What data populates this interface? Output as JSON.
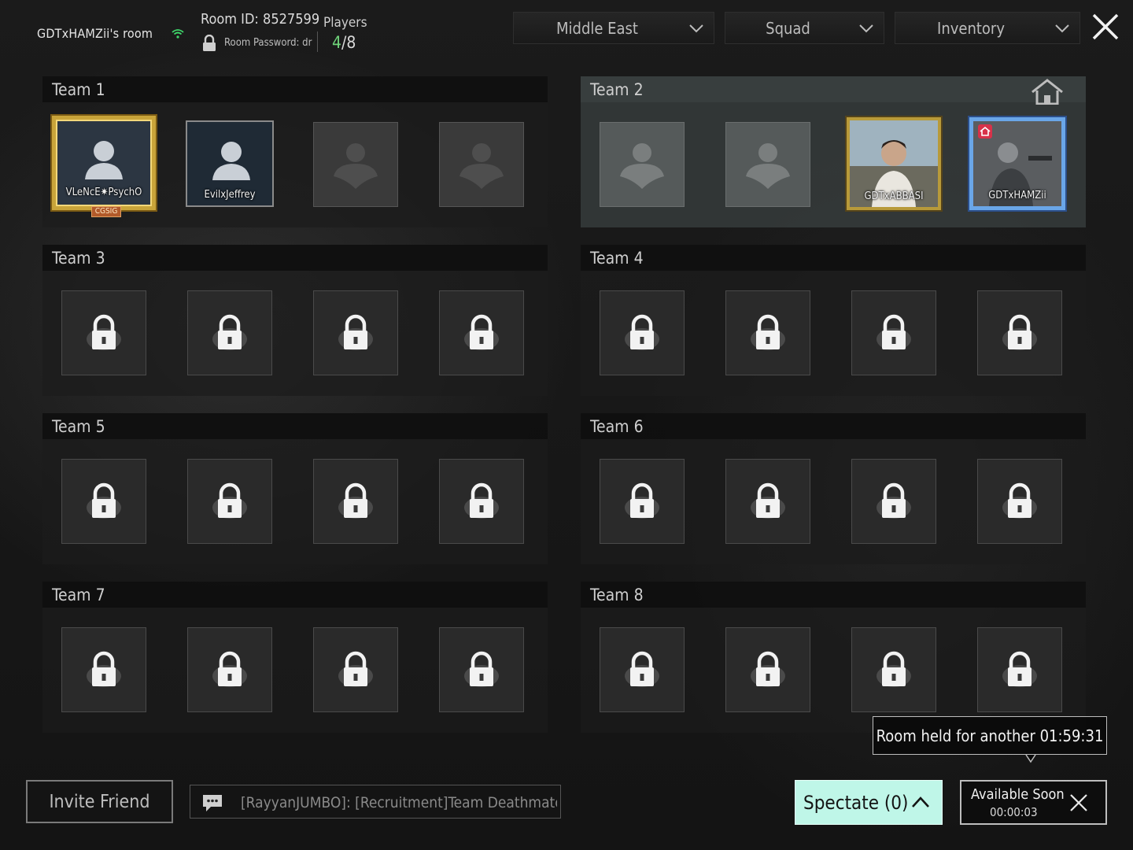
{
  "header": {
    "room_owner": "GDTxHAMZii's room",
    "room_id": "Room ID: 8527599",
    "room_password": "Room Password: dr",
    "players_label": "Players",
    "players_current": "4",
    "players_max": "/8",
    "region": "Middle East",
    "mode": "Squad",
    "inventory": "Inventory"
  },
  "teams": [
    {
      "name": "Team 1",
      "players": [
        "VLeNcE✷PsychO",
        "EvilxJeffrey"
      ],
      "clan_tag": "CGSIG"
    },
    {
      "name": "Team 2",
      "players": [
        "GDTxABBASI",
        "GDTxHAMZii"
      ]
    },
    {
      "name": "Team 3"
    },
    {
      "name": "Team 4"
    },
    {
      "name": "Team 5"
    },
    {
      "name": "Team 6"
    },
    {
      "name": "Team 7"
    },
    {
      "name": "Team 8"
    }
  ],
  "footer": {
    "room_held": "Room held for another 01:59:31",
    "invite_label": "Invite Friend",
    "chat_message": "[RayyanJUMBO]: [Recruitment]Team Deathmatc",
    "spectate_label": "Spectate (0)",
    "available_label": "Available Soon",
    "available_time": "00:00:03"
  },
  "icons": {
    "wifi": "wifi-icon",
    "lock": "lock-icon",
    "close": "close-icon",
    "chevron": "chevron-down-icon",
    "home": "home-icon",
    "chat": "chat-bubble-icon",
    "person": "person-silhouette-icon"
  },
  "colors": {
    "players_current": "#6fd37a",
    "spectate_bg": "#bff6e8",
    "active_team_bg": "#464e4e"
  }
}
